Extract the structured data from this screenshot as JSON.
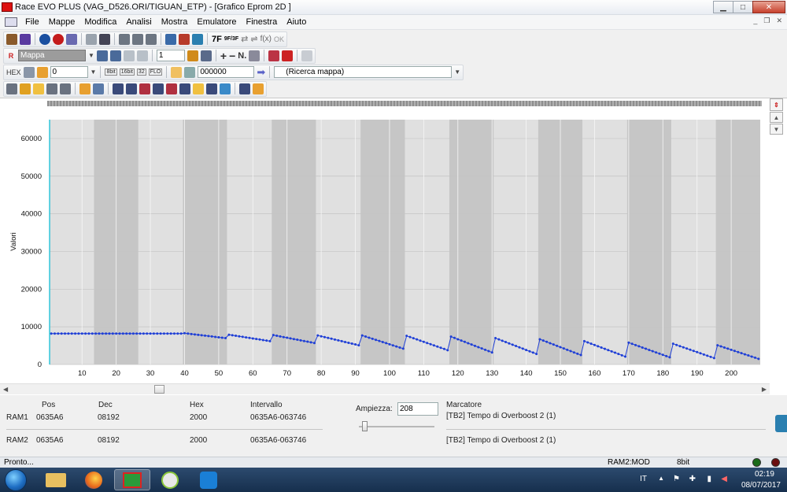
{
  "window": {
    "title": "Race EVO PLUS (VAG_D526.ORI/TIGUAN_ETP) - [Grafico Eprom 2D ]",
    "minimize_glyph": "▁",
    "maximize_glyph": "□",
    "close_glyph": "✕",
    "mdi_minimize": "_",
    "mdi_restore": "❐",
    "mdi_close": "✕"
  },
  "menu": [
    "File",
    "Mappe",
    "Modifica",
    "Analisi",
    "Mostra",
    "Emulatore",
    "Finestra",
    "Aiuto"
  ],
  "toolbar": {
    "row1_text": [
      "7F",
      "9F/3F",
      "f(x)",
      "OK"
    ],
    "row2": {
      "map_prefix": "R",
      "map_select": "Mappa",
      "step_value": "1",
      "n_label": "N."
    },
    "row3": {
      "hex_label": "HEX",
      "offset_value": "0",
      "address_value": "000000",
      "search_select": "(Ricerca mappa)",
      "bit8_label": "8bit",
      "bit16_label": "16bit",
      "flo_label": "FLO"
    }
  },
  "chart_data": {
    "type": "line",
    "ylabel": "Valori",
    "xlim": [
      1,
      208
    ],
    "ylim": [
      0,
      65000
    ],
    "y_ticks": [
      0,
      10000,
      20000,
      30000,
      40000,
      50000,
      60000
    ],
    "x_ticks": [
      10,
      20,
      30,
      40,
      50,
      60,
      70,
      80,
      90,
      100,
      110,
      120,
      130,
      140,
      150,
      160,
      170,
      180,
      190,
      200
    ],
    "band_width": 13,
    "band_colors": [
      "#e0e0e0",
      "#c6c6c6"
    ],
    "line_color": "#1f3fd6",
    "grid": true,
    "segments": [
      {
        "start": 1,
        "end": 39,
        "from": 8192,
        "to": 8192
      },
      {
        "start": 40,
        "end": 52,
        "from": 8300,
        "to": 7000
      },
      {
        "start": 53,
        "end": 65,
        "from": 7900,
        "to": 6200
      },
      {
        "start": 66,
        "end": 78,
        "from": 7800,
        "to": 5700
      },
      {
        "start": 79,
        "end": 91,
        "from": 7700,
        "to": 5100
      },
      {
        "start": 92,
        "end": 104,
        "from": 7700,
        "to": 4200
      },
      {
        "start": 105,
        "end": 117,
        "from": 7600,
        "to": 3800
      },
      {
        "start": 118,
        "end": 130,
        "from": 7400,
        "to": 3200
      },
      {
        "start": 131,
        "end": 143,
        "from": 7000,
        "to": 2800
      },
      {
        "start": 144,
        "end": 156,
        "from": 6700,
        "to": 2500
      },
      {
        "start": 157,
        "end": 169,
        "from": 6200,
        "to": 2100
      },
      {
        "start": 170,
        "end": 182,
        "from": 5800,
        "to": 1900
      },
      {
        "start": 183,
        "end": 195,
        "from": 5500,
        "to": 1700
      },
      {
        "start": 196,
        "end": 208,
        "from": 5100,
        "to": 1500
      }
    ]
  },
  "info": {
    "headers": {
      "pos": "Pos",
      "dec": "Dec",
      "hex": "Hex",
      "intervallo": "Intervallo",
      "marcatore": "Marcatore"
    },
    "rows": [
      {
        "name": "RAM1",
        "pos": "0635A6",
        "dec": "08192",
        "hex": "2000",
        "intervallo": "0635A6-063746",
        "marker": "[TB2] Tempo di Overboost 2 (1)"
      },
      {
        "name": "RAM2",
        "pos": "0635A6",
        "dec": "08192",
        "hex": "2000",
        "intervallo": "0635A6-063746",
        "marker": "[TB2] Tempo di Overboost 2 (1)"
      }
    ],
    "amplitude_label": "Ampiezza:",
    "amplitude_value": "208",
    "amplitude_slider": 0.07
  },
  "status": {
    "left": "Pronto...",
    "ram": "RAM2:MOD",
    "bits": "8bit",
    "led1_color": "#1a6b1a",
    "led2_color": "#6b0e0e"
  },
  "taskbar": {
    "language": "IT",
    "time": "02:19",
    "date": "08/07/2017"
  },
  "colors": {
    "accent": "#1f3fd6",
    "cursor": "#00bcd4"
  }
}
